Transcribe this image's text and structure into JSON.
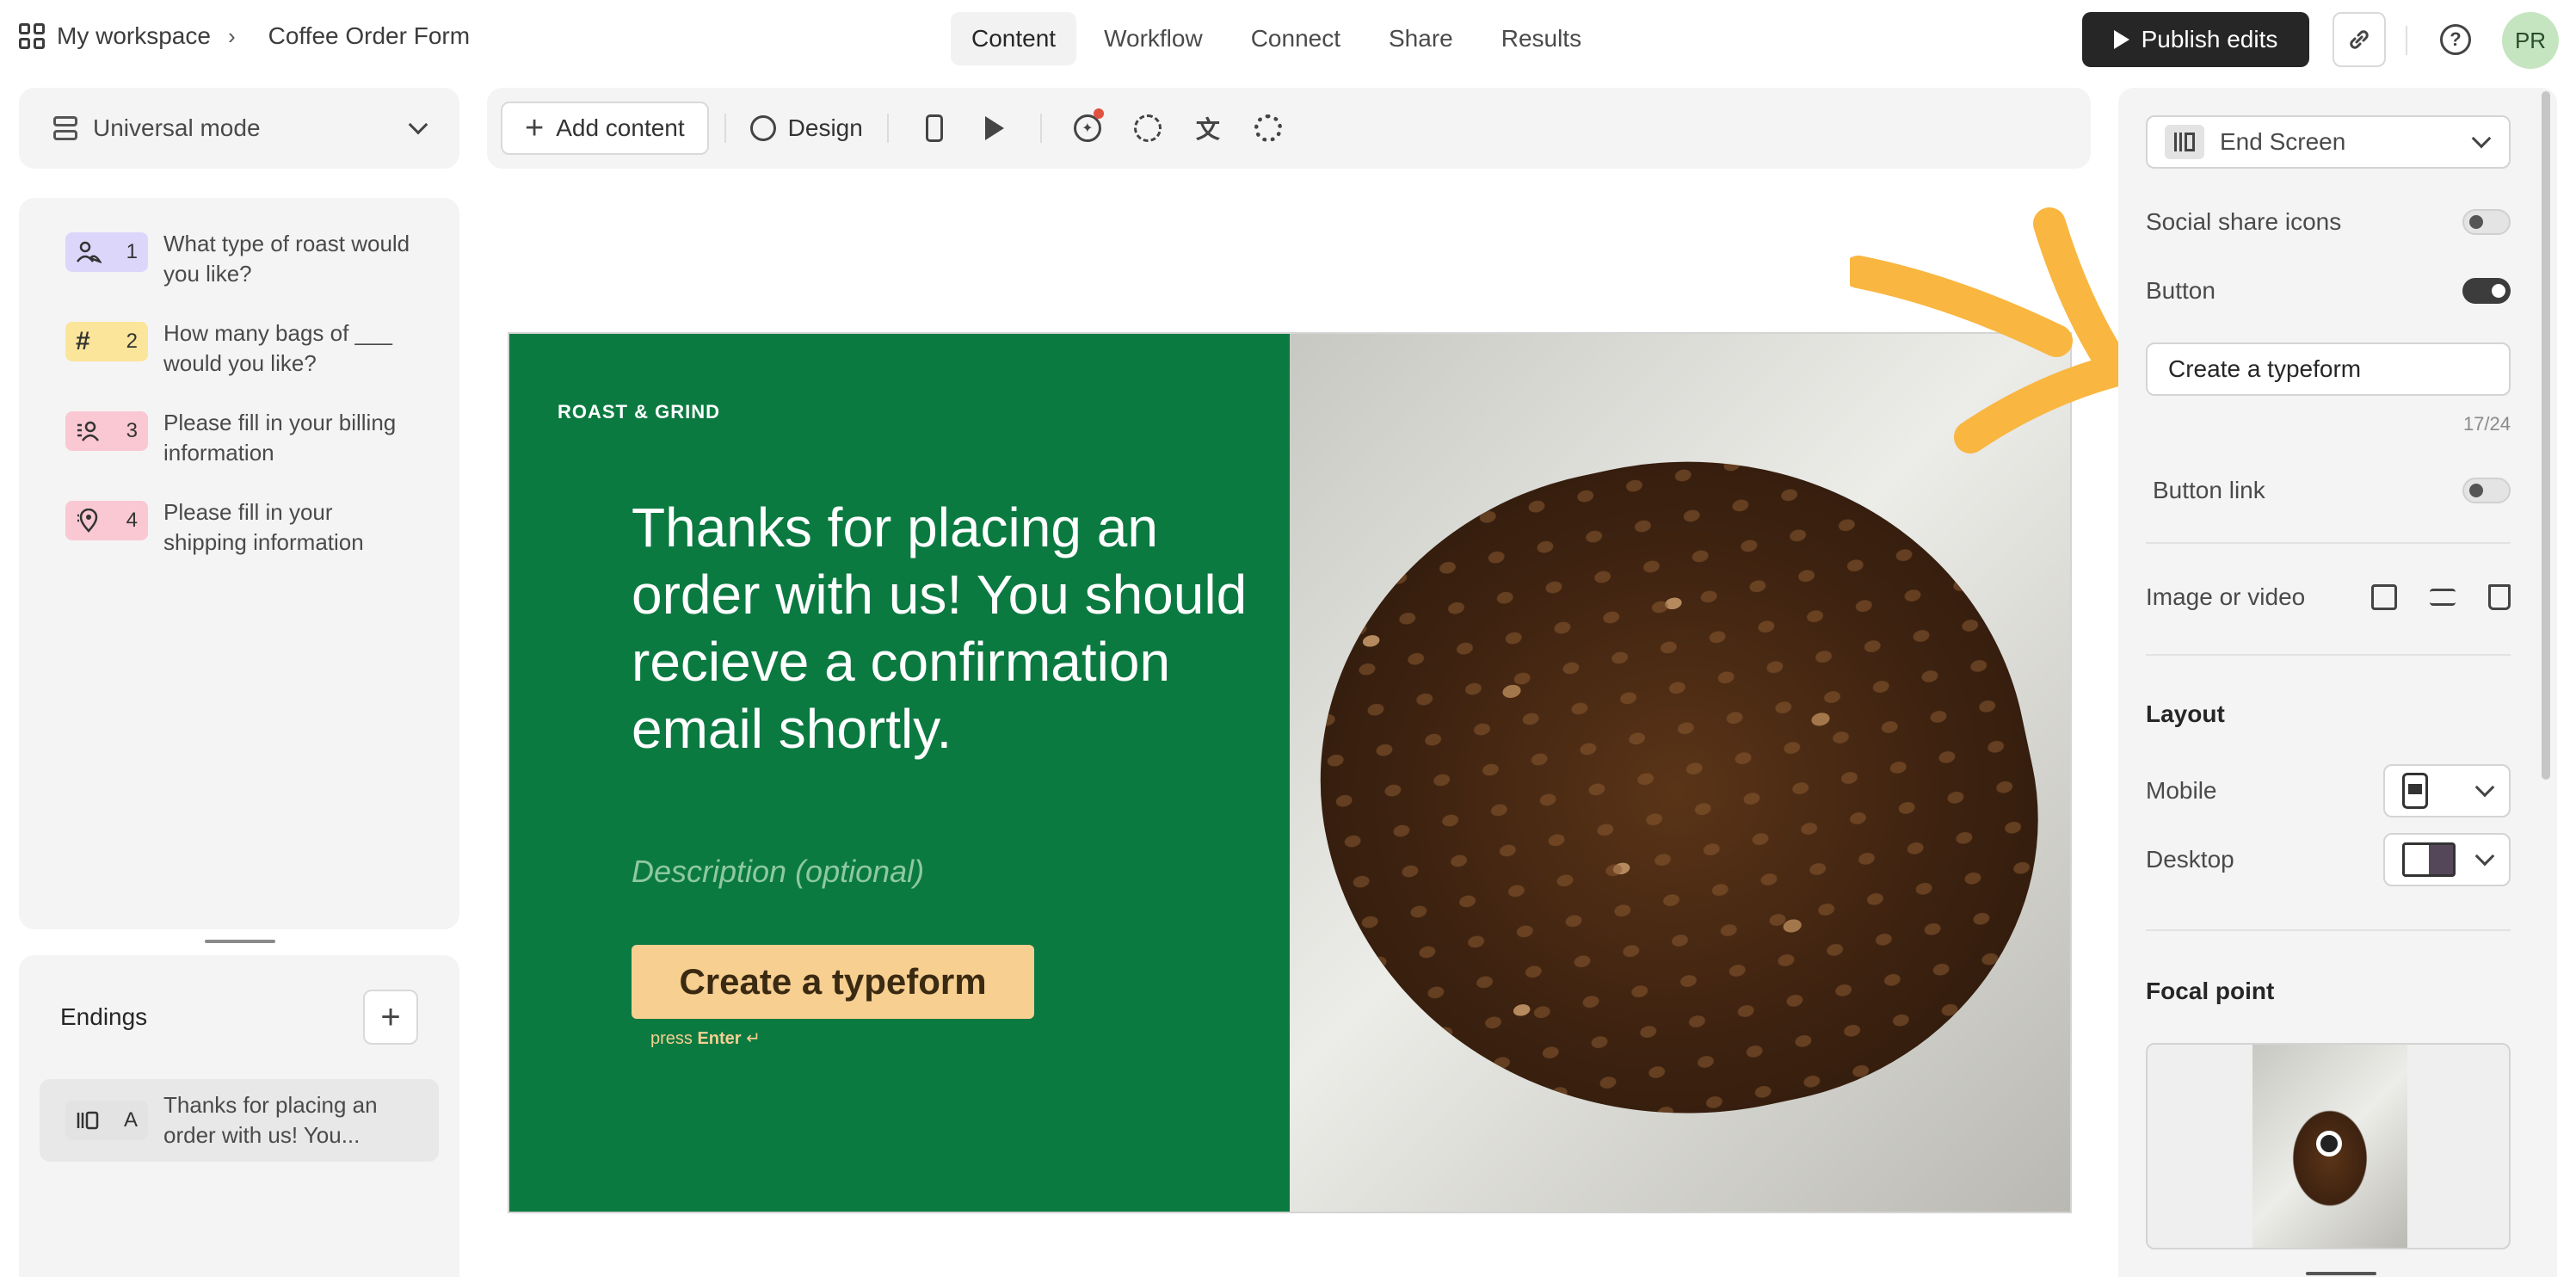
{
  "breadcrumb": {
    "workspace": "My workspace",
    "separator": "›",
    "form_name": "Coffee Order Form"
  },
  "nav_tabs": [
    {
      "label": "Content",
      "active": true
    },
    {
      "label": "Workflow",
      "active": false
    },
    {
      "label": "Connect",
      "active": false
    },
    {
      "label": "Share",
      "active": false
    },
    {
      "label": "Results",
      "active": false
    }
  ],
  "header": {
    "publish_label": "Publish edits",
    "avatar_initials": "PR"
  },
  "mode_selector": {
    "label": "Universal mode"
  },
  "questions": [
    {
      "number": "1",
      "text": "What type of roast would you like?",
      "icon": "picture-choice-icon",
      "color": "#dcd6fb"
    },
    {
      "number": "2",
      "text": "How many bags of ___ would you like?",
      "icon": "hash-icon",
      "color": "#fbe59a"
    },
    {
      "number": "3",
      "text": "Please fill in your billing information",
      "icon": "contact-info-icon",
      "color": "#f9c8d3"
    },
    {
      "number": "4",
      "text": "Please fill in your shipping information",
      "icon": "address-icon",
      "color": "#f9c8d3"
    }
  ],
  "endings": {
    "title": "Endings",
    "add_label": "+",
    "items": [
      {
        "letter": "A",
        "text": "Thanks for placing an order with us! You..."
      }
    ]
  },
  "toolbar": {
    "add_content_label": "Add content",
    "design_label": "Design"
  },
  "canvas": {
    "brand": "ROAST & GRIND",
    "headline": "Thanks for placing an order with us! You should recieve a confirmation email shortly.",
    "description_placeholder": "Description (optional)",
    "button_label": "Create a typeform",
    "press_hint_prefix": "press",
    "press_hint_key": "Enter",
    "press_hint_symbol": "↵",
    "bg_color": "#0b7a41",
    "button_color": "#f6cf91"
  },
  "settings": {
    "screen_type": "End Screen",
    "social_share_label": "Social share icons",
    "social_share_enabled": false,
    "button_label": "Button",
    "button_enabled": true,
    "button_text": "Create a typeform",
    "char_count": "17/24",
    "button_link_label": "Button link",
    "button_link_enabled": false,
    "image_label": "Image or video",
    "layout_title": "Layout",
    "mobile_label": "Mobile",
    "desktop_label": "Desktop",
    "focal_point_title": "Focal point"
  },
  "accent_colors": {
    "annotation_arrow": "#f9b640"
  }
}
